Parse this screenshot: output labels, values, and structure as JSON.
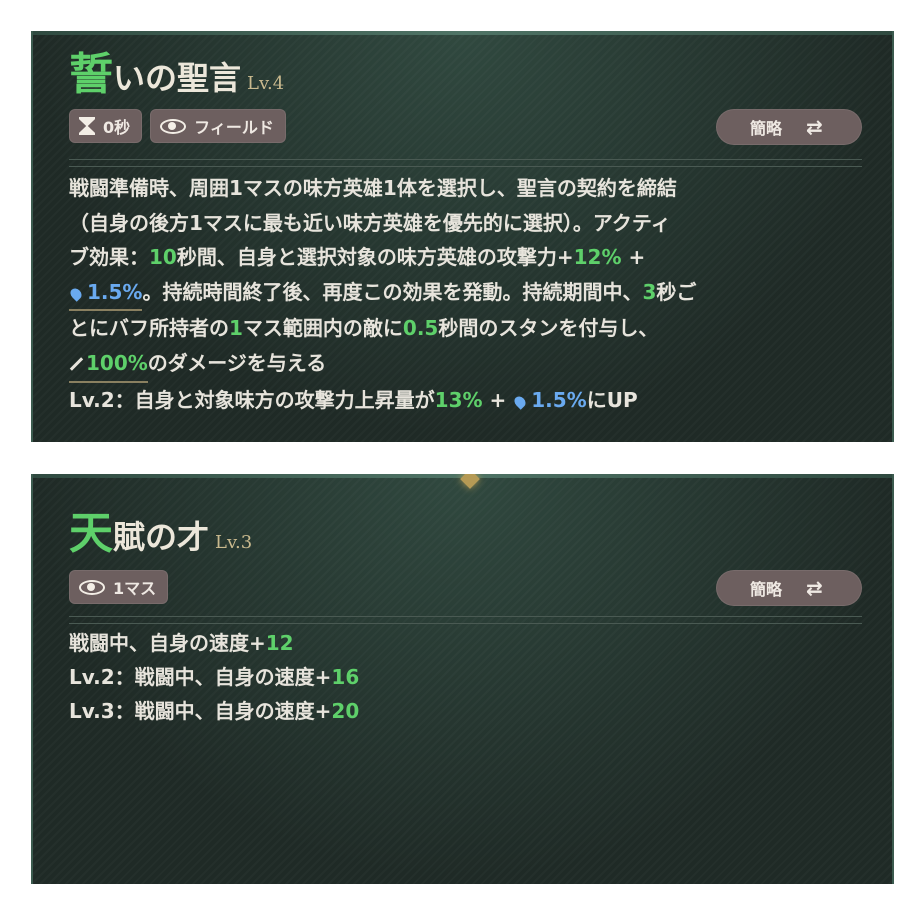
{
  "skills": [
    {
      "title_first": "誓",
      "title_rest": "いの聖言",
      "level": "Lv.4",
      "tag_cooldown": "0秒",
      "tag_range": "フィールド",
      "toggle_label": "簡略",
      "toggle_icon": "⇄",
      "desc": {
        "l1": "戦闘準備時、周囲1マスの味方英雄1体を選択し、聖言の契約を締結",
        "l2": "（自身の後方1マスに最も近い味方英雄を優先的に選択）。アクティ",
        "l3a": "ブ効果：",
        "l3b": "10",
        "l3c": "秒間、自身と選択対象の味方英雄の攻撃力+",
        "l3d": "12%",
        "l3e": " +",
        "l4a": "1.5%",
        "l4b": "。持続時間終了後、再度この効果を発動。持続期間中、",
        "l4c": "3",
        "l4d": "秒ご",
        "l5a": "とにバフ所持者の",
        "l5b": "1",
        "l5c": "マス範囲内の敵に",
        "l5d": "0.5",
        "l5e": "秒間のスタンを付与し、",
        "l6a": "100%",
        "l6b": "のダメージを与える",
        "l7a": "Lv.2：自身と対象味方の攻撃力上昇量が",
        "l7b": "13%",
        "l7c": " + ",
        "l7d": "1.5%",
        "l7e": "にUP"
      }
    },
    {
      "title_first": "天",
      "title_rest": "賦の才",
      "level": "Lv.3",
      "tag_range": "1マス",
      "toggle_label": "簡略",
      "toggle_icon": "⇄",
      "desc": {
        "l1a": "戦闘中、自身の速度+",
        "l1b": "12",
        "l2a": "Lv.2：戦闘中、自身の速度+",
        "l2b": "16",
        "l3a": "Lv.3：戦闘中、自身の速度+",
        "l3b": "20"
      }
    }
  ],
  "colors": {
    "accent_green": "#5ed06a",
    "accent_blue": "#6aaaf0",
    "panel_bg": "#1f2a26",
    "tag_bg": "#6d5f5f"
  },
  "icons": [
    "hourglass-icon",
    "eye-icon",
    "swap-icon",
    "water-drop-icon",
    "sword-icon"
  ]
}
